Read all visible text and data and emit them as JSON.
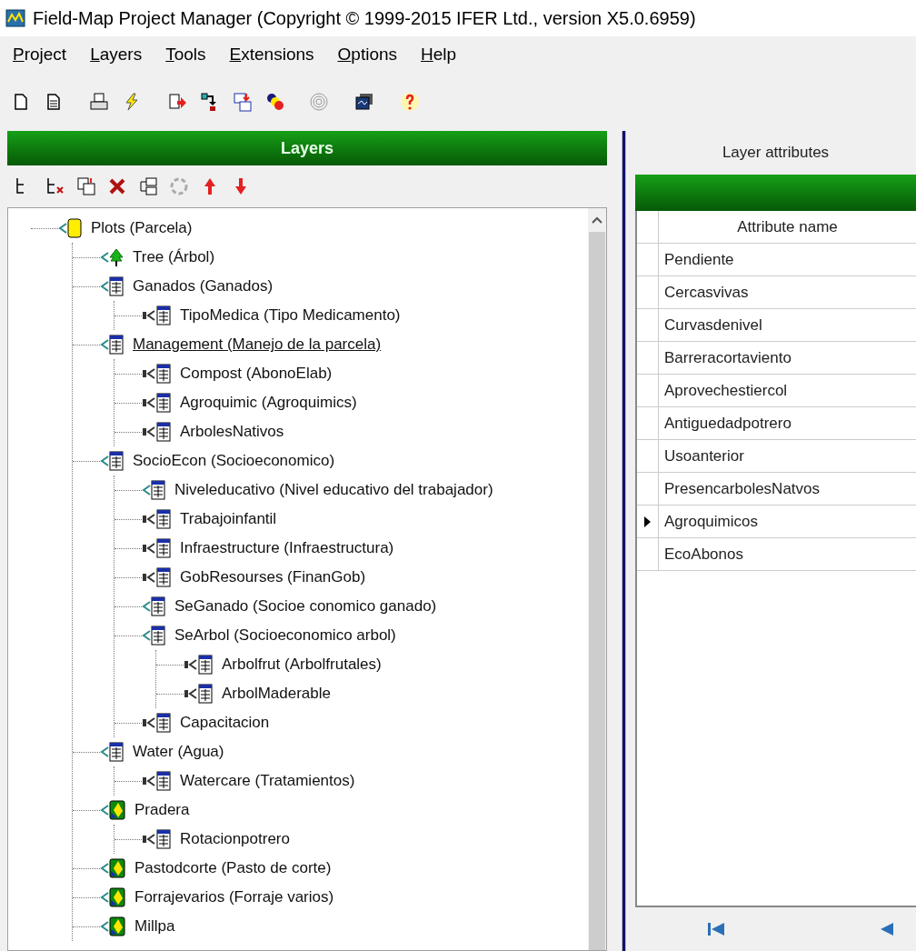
{
  "window": {
    "title": "Field-Map Project Manager (Copyright © 1999-2015 IFER Ltd., version X5.0.6959)"
  },
  "menu": [
    "Project",
    "Layers",
    "Tools",
    "Extensions",
    "Options",
    "Help"
  ],
  "layers_panel": {
    "title": "Layers",
    "tree": [
      {
        "label": "Plots (Parcela)",
        "kind": "plot",
        "linked": false,
        "selected": false,
        "children": [
          {
            "label": "Tree (Árbol)",
            "kind": "tree",
            "linked": false,
            "selected": false
          },
          {
            "label": "Ganados (Ganados)",
            "kind": "table",
            "linked": false,
            "selected": false,
            "children": [
              {
                "label": "TipoMedica (Tipo Medicamento)",
                "kind": "table",
                "linked": true,
                "selected": false
              }
            ]
          },
          {
            "label": "Management (Manejo de la parcela)",
            "kind": "table",
            "linked": false,
            "selected": true,
            "children": [
              {
                "label": "Compost (AbonoElab)",
                "kind": "table",
                "linked": true,
                "selected": false
              },
              {
                "label": "Agroquimic (Agroquimics)",
                "kind": "table",
                "linked": true,
                "selected": false
              },
              {
                "label": "ArbolesNativos",
                "kind": "table",
                "linked": true,
                "selected": false
              }
            ]
          },
          {
            "label": "SocioEcon (Socioeconomico)",
            "kind": "table",
            "linked": false,
            "selected": false,
            "children": [
              {
                "label": "Niveleducativo (Nivel educativo del trabajador)",
                "kind": "table",
                "linked": false,
                "selected": false
              },
              {
                "label": "Trabajoinfantil",
                "kind": "table",
                "linked": true,
                "selected": false
              },
              {
                "label": "Infraestructure (Infraestructura)",
                "kind": "table",
                "linked": true,
                "selected": false
              },
              {
                "label": "GobResourses (FinanGob)",
                "kind": "table",
                "linked": true,
                "selected": false
              },
              {
                "label": "SeGanado (Socioe conomico ganado)",
                "kind": "table",
                "linked": false,
                "selected": false
              },
              {
                "label": "SeArbol (Socioeconomico arbol)",
                "kind": "table",
                "linked": false,
                "selected": false,
                "children": [
                  {
                    "label": "Arbolfrut (Arbolfrutales)",
                    "kind": "table",
                    "linked": true,
                    "selected": false
                  },
                  {
                    "label": "ArbolMaderable",
                    "kind": "table",
                    "linked": true,
                    "selected": false
                  }
                ]
              },
              {
                "label": "Capacitacion",
                "kind": "table",
                "linked": true,
                "selected": false
              }
            ]
          },
          {
            "label": "Water (Agua)",
            "kind": "table",
            "linked": false,
            "selected": false,
            "children": [
              {
                "label": "Watercare (Tratamientos)",
                "kind": "table",
                "linked": true,
                "selected": false
              }
            ]
          },
          {
            "label": "Pradera",
            "kind": "area",
            "linked": false,
            "selected": false,
            "children": [
              {
                "label": "Rotacionpotrero",
                "kind": "table",
                "linked": true,
                "selected": false
              }
            ]
          },
          {
            "label": "Pastodcorte (Pasto de corte)",
            "kind": "area",
            "linked": false,
            "selected": false
          },
          {
            "label": "Forrajevarios (Forraje varios)",
            "kind": "area",
            "linked": false,
            "selected": false
          },
          {
            "label": "Millpa",
            "kind": "area",
            "linked": false,
            "selected": false
          }
        ]
      }
    ]
  },
  "attributes_panel": {
    "title": "Layer attributes",
    "column": "Attribute name",
    "rows": [
      {
        "name": "Pendiente",
        "selected": false
      },
      {
        "name": "Cercasvivas",
        "selected": false
      },
      {
        "name": "Curvasdenivel",
        "selected": false
      },
      {
        "name": "Barreracortaviento",
        "selected": false
      },
      {
        "name": "Aprovechestiercol",
        "selected": false
      },
      {
        "name": "Antiguedadpotrero",
        "selected": false
      },
      {
        "name": "Usoanterior",
        "selected": false
      },
      {
        "name": "PresencarbolesNatvos",
        "selected": false
      },
      {
        "name": "Agroquimicos",
        "selected": true
      },
      {
        "name": "EcoAbonos",
        "selected": false
      }
    ]
  }
}
